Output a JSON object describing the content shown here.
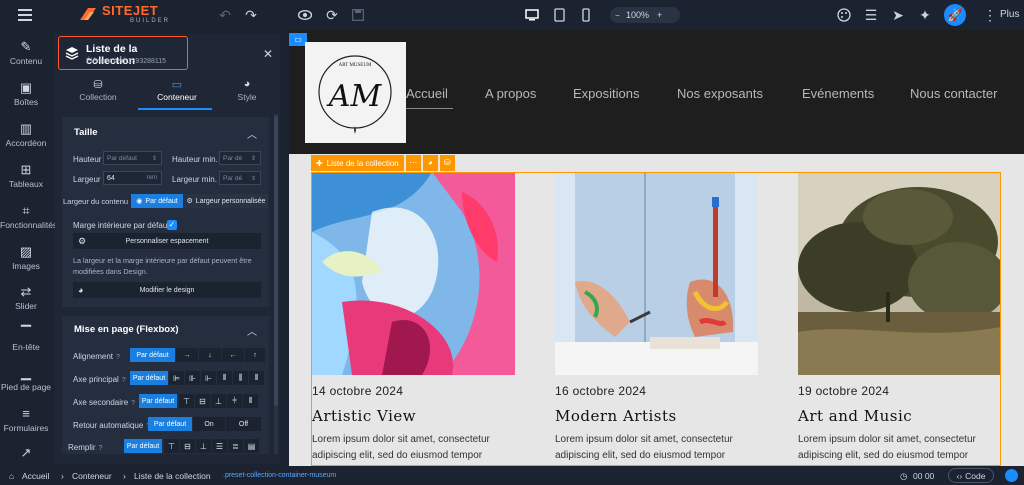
{
  "app": {
    "logo_name": "SITEJET",
    "logo_sub": "BUILDER",
    "zoom": "100%",
    "more_label": "Plus",
    "accent": "#1a8cff",
    "brand": "#ff6b2c"
  },
  "leftnav": [
    {
      "label": "Contenu",
      "icon": "pencil-icon"
    },
    {
      "label": "Boîtes",
      "icon": "box-icon"
    },
    {
      "label": "Accordéon",
      "icon": "accordion-icon"
    },
    {
      "label": "Tableaux",
      "icon": "table-icon"
    },
    {
      "label": "Fonctionnalités",
      "icon": "functions-icon"
    },
    {
      "label": "Images",
      "icon": "image-icon"
    },
    {
      "label": "Slider",
      "icon": "slider-icon"
    },
    {
      "label": "En-tête",
      "icon": "header-icon"
    },
    {
      "label": "Pied de page",
      "icon": "footer-icon"
    },
    {
      "label": "Formulaires",
      "icon": "form-icon"
    },
    {
      "label": "",
      "icon": "chart-icon"
    }
  ],
  "panel": {
    "title": "Liste de la collection",
    "subtitle": "Élément #ed-1393288115",
    "tabs": [
      {
        "label": "Collection",
        "icon": "stack-icon"
      },
      {
        "label": "Conteneur",
        "icon": "container-icon"
      },
      {
        "label": "Style",
        "icon": "palette-icon"
      }
    ],
    "taille": {
      "title": "Taille",
      "hauteur_label": "Hauteur",
      "hauteur_placeholder": "Par défaut",
      "hauteur_min_label": "Hauteur min.",
      "hauteur_min_placeholder": "Par dé",
      "largeur_label": "Largeur",
      "largeur_value": "64",
      "largeur_unit": "rem",
      "largeur_min_label": "Largeur min.",
      "largeur_min_placeholder": "Par dé",
      "largeur_contenu_label": "Largeur du contenu",
      "par_defaut": "Par défaut",
      "largeur_perso": "Largeur personnalisée",
      "marge_label": "Marge intérieure par défaut",
      "personnaliser_btn": "Personnaliser espacement",
      "note": "La largeur et la marge intérieure par défaut peuvent être modifiées dans Design.",
      "modifier_btn": "Modifier le design"
    },
    "flex": {
      "title": "Mise en page (Flexbox)",
      "alignement": "Alignement",
      "axe_principal": "Axe principal",
      "axe_secondaire": "Axe secondaire",
      "retour": "Retour automatique",
      "remplir": "Remplir",
      "par_defaut": "Par défaut",
      "on": "On",
      "off": "Off"
    }
  },
  "site": {
    "nav": [
      "Accueil",
      "A propos",
      "Expositions",
      "Nos exposants",
      "Evénements",
      "Nous contacter"
    ],
    "logo_text": "ART MUSEUM",
    "collection_tag": "Liste de la collection",
    "cards": [
      {
        "date": "14 octobre 2024",
        "title": "Artistic View",
        "text": "Lorem ipsum dolor sit amet, consectetur adipiscing elit, sed do eiusmod tempor"
      },
      {
        "date": "16 octobre 2024",
        "title": "Modern Artists",
        "text": "Lorem ipsum dolor sit amet, consectetur adipiscing elit, sed do eiusmod tempor"
      },
      {
        "date": "19 octobre 2024",
        "title": "Art and Music",
        "text": "Lorem ipsum dolor sit amet, consectetur adipiscing elit, sed do eiusmod tempor"
      }
    ]
  },
  "bottombar": {
    "crumbs": [
      "Accueil",
      "Conteneur",
      "Liste de la collection"
    ],
    "class_name": ".preset-collection-container-museum",
    "time": "00 00",
    "code_label": "Code"
  }
}
